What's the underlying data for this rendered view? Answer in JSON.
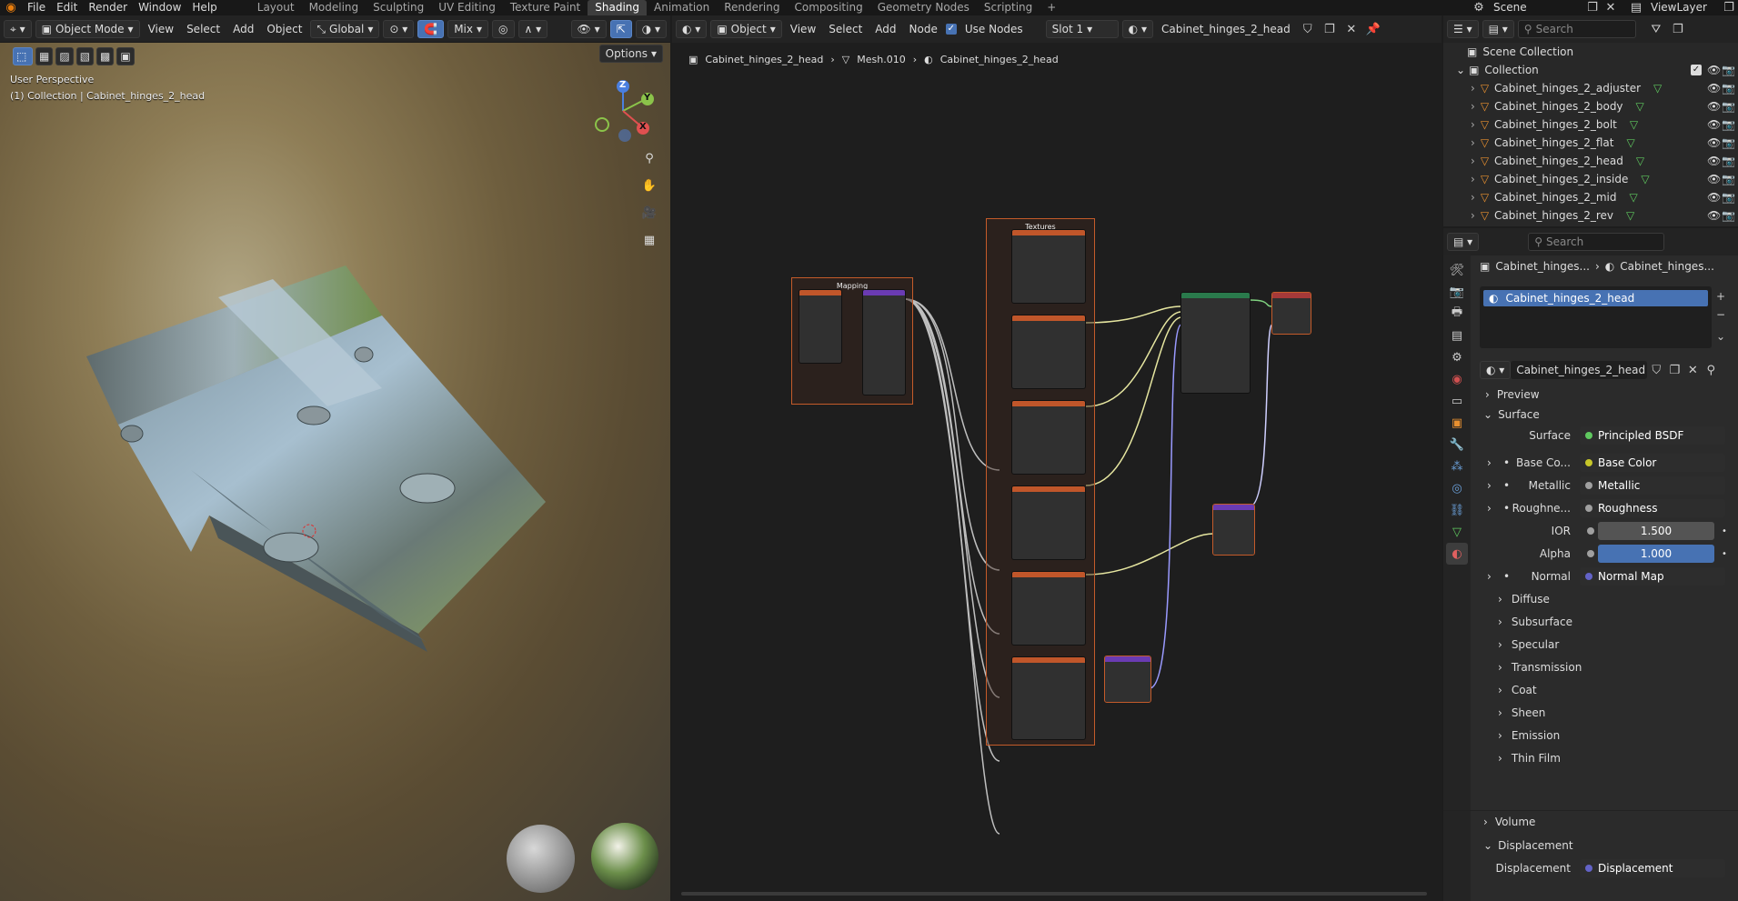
{
  "menu": [
    "File",
    "Edit",
    "Render",
    "Window",
    "Help"
  ],
  "workspaces": [
    "Layout",
    "Modeling",
    "Sculpting",
    "UV Editing",
    "Texture Paint",
    "Shading",
    "Animation",
    "Rendering",
    "Compositing",
    "Geometry Nodes",
    "Scripting"
  ],
  "active_workspace": "Shading",
  "scene": "Scene",
  "view_layer": "ViewLayer",
  "viewport": {
    "mode": "Object Mode",
    "menus": [
      "View",
      "Select",
      "Add",
      "Object"
    ],
    "transform": "Global",
    "shading": "Mix",
    "options": "Options",
    "info_line1": "User Perspective",
    "info_line2": "(1) Collection | Cabinet_hinges_2_head",
    "gizmo": {
      "x": "X",
      "y": "Y",
      "z": "Z"
    }
  },
  "node_editor": {
    "type": "Object",
    "menus": [
      "View",
      "Select",
      "Add",
      "Node"
    ],
    "use_nodes": "Use Nodes",
    "slot": "Slot 1",
    "material": "Cabinet_hinges_2_head",
    "breadcrumb": [
      "Cabinet_hinges_2_head",
      "Mesh.010",
      "Cabinet_hinges_2_head"
    ],
    "frame_mapping": "Mapping",
    "frame_textures": "Textures"
  },
  "outliner": {
    "search_placeholder": "Search",
    "scene_collection": "Scene Collection",
    "collection": "Collection",
    "items": [
      "Cabinet_hinges_2_adjuster",
      "Cabinet_hinges_2_body",
      "Cabinet_hinges_2_bolt",
      "Cabinet_hinges_2_flat",
      "Cabinet_hinges_2_head",
      "Cabinet_hinges_2_inside",
      "Cabinet_hinges_2_mid",
      "Cabinet_hinges_2_rev"
    ]
  },
  "properties": {
    "search_placeholder": "Search",
    "crumb_object": "Cabinet_hinges...",
    "crumb_material": "Cabinet_hinges...",
    "slot_item": "Cabinet_hinges_2_head",
    "material_name": "Cabinet_hinges_2_head",
    "preview": "Preview",
    "surface_panel": "Surface",
    "surface_label": "Surface",
    "surface_value": "Principled BSDF",
    "base_color_label": "Base Co...",
    "base_color_value": "Base Color",
    "metallic_label": "Metallic",
    "metallic_value": "Metallic",
    "roughness_label": "Roughne...",
    "roughness_value": "Roughness",
    "ior_label": "IOR",
    "ior_value": "1.500",
    "alpha_label": "Alpha",
    "alpha_value": "1.000",
    "normal_label": "Normal",
    "normal_value": "Normal Map",
    "subpanels": [
      "Diffuse",
      "Subsurface",
      "Specular",
      "Transmission",
      "Coat",
      "Sheen",
      "Emission",
      "Thin Film"
    ],
    "volume": "Volume",
    "displacement_panel": "Displacement",
    "displacement_label": "Displacement",
    "displacement_value": "Displacement"
  },
  "colors": {
    "accent": "#4772b3",
    "frame": "#c45b2a",
    "shader_header": "#2a7a4c",
    "texture_header": "#c0562a",
    "vector_header": "#6a3bb3"
  }
}
